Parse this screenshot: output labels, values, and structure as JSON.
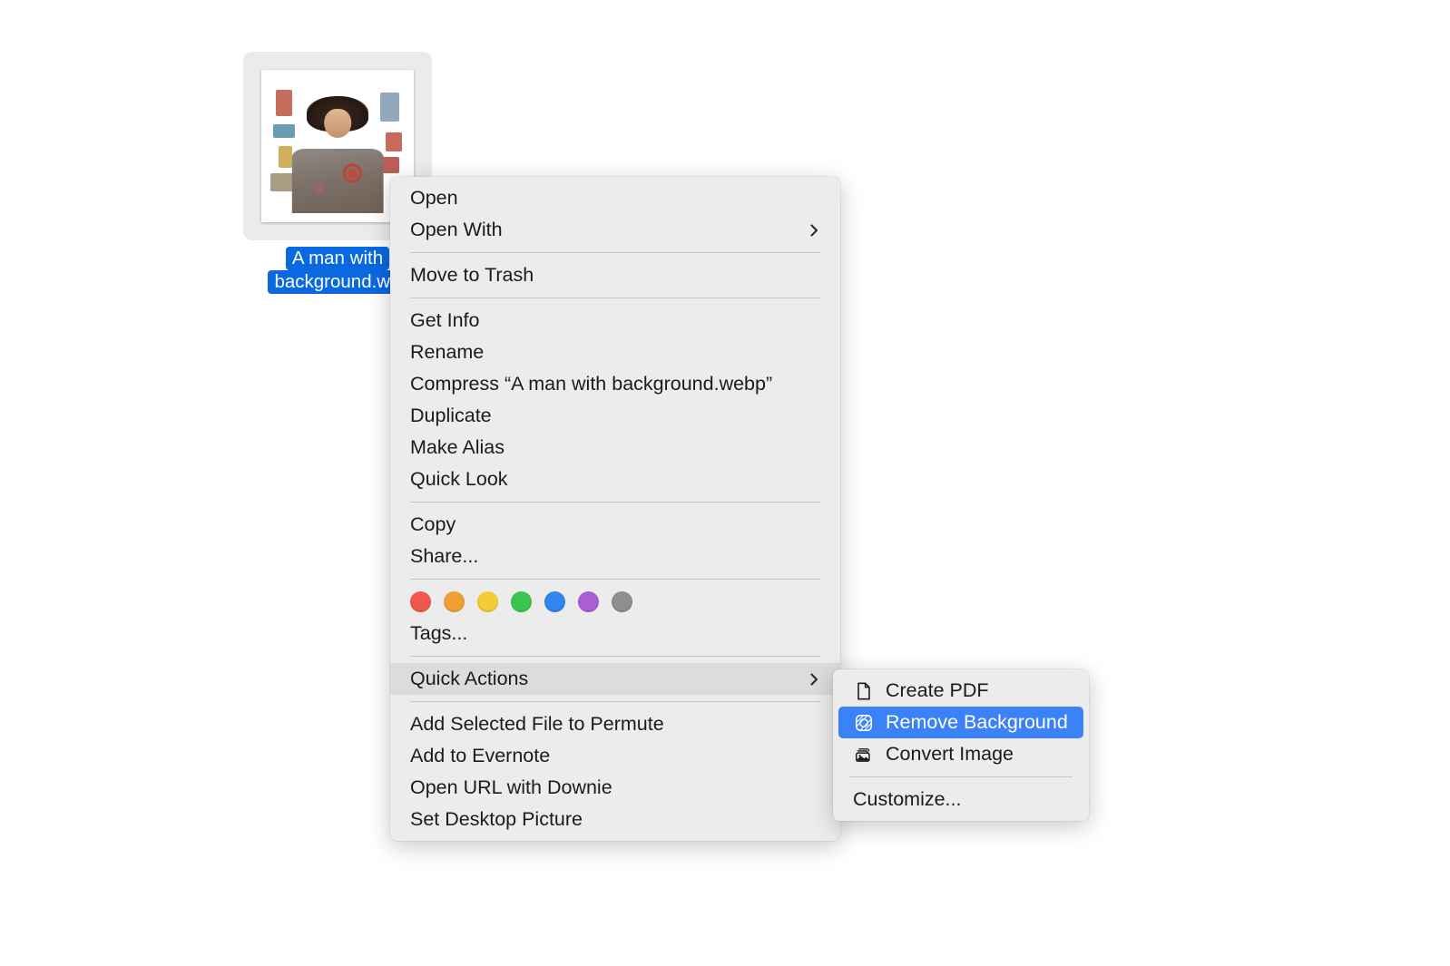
{
  "desktop": {
    "file": {
      "name_line1": "A man with",
      "name_line2": "background.we",
      "full_name": "A man with background.webp",
      "selection_color": "#ebebeb",
      "label_highlight_color": "#0a68e0"
    }
  },
  "context_menu": {
    "groups": [
      {
        "items": [
          {
            "label": "Open",
            "has_submenu": false
          },
          {
            "label": "Open With",
            "has_submenu": true
          }
        ]
      },
      {
        "items": [
          {
            "label": "Move to Trash",
            "has_submenu": false
          }
        ]
      },
      {
        "items": [
          {
            "label": "Get Info",
            "has_submenu": false
          },
          {
            "label": "Rename",
            "has_submenu": false
          },
          {
            "label": "Compress “A man with background.webp”",
            "has_submenu": false
          },
          {
            "label": "Duplicate",
            "has_submenu": false
          },
          {
            "label": "Make Alias",
            "has_submenu": false
          },
          {
            "label": "Quick Look",
            "has_submenu": false
          }
        ]
      },
      {
        "items": [
          {
            "label": "Copy",
            "has_submenu": false
          },
          {
            "label": "Share...",
            "has_submenu": false
          }
        ]
      },
      {
        "tags": {
          "colors": [
            {
              "name": "red-tag",
              "hex": "#f0584c"
            },
            {
              "name": "orange-tag",
              "hex": "#f0a033"
            },
            {
              "name": "yellow-tag",
              "hex": "#f5cc33"
            },
            {
              "name": "green-tag",
              "hex": "#3cc54e"
            },
            {
              "name": "blue-tag",
              "hex": "#2f86ef"
            },
            {
              "name": "purple-tag",
              "hex": "#ab5ed4"
            },
            {
              "name": "grey-tag",
              "hex": "#8e8e8e"
            }
          ]
        },
        "items": [
          {
            "label": "Tags...",
            "has_submenu": false
          }
        ]
      },
      {
        "items": [
          {
            "label": "Quick Actions",
            "has_submenu": true,
            "highlighted": true
          }
        ]
      },
      {
        "items": [
          {
            "label": "Add Selected File to Permute",
            "has_submenu": false
          },
          {
            "label": "Add to Evernote",
            "has_submenu": false
          },
          {
            "label": "Open URL with Downie",
            "has_submenu": false
          },
          {
            "label": "Set Desktop Picture",
            "has_submenu": false
          }
        ]
      }
    ]
  },
  "submenu": {
    "title": "Quick Actions",
    "items": [
      {
        "label": "Create PDF",
        "icon": "document-icon",
        "selected": false
      },
      {
        "label": "Remove Background",
        "icon": "remove-background-icon",
        "selected": true
      },
      {
        "label": "Convert Image",
        "icon": "photo-stack-icon",
        "selected": false
      }
    ],
    "footer": {
      "label": "Customize..."
    },
    "selection_color": "#3b82f6"
  }
}
